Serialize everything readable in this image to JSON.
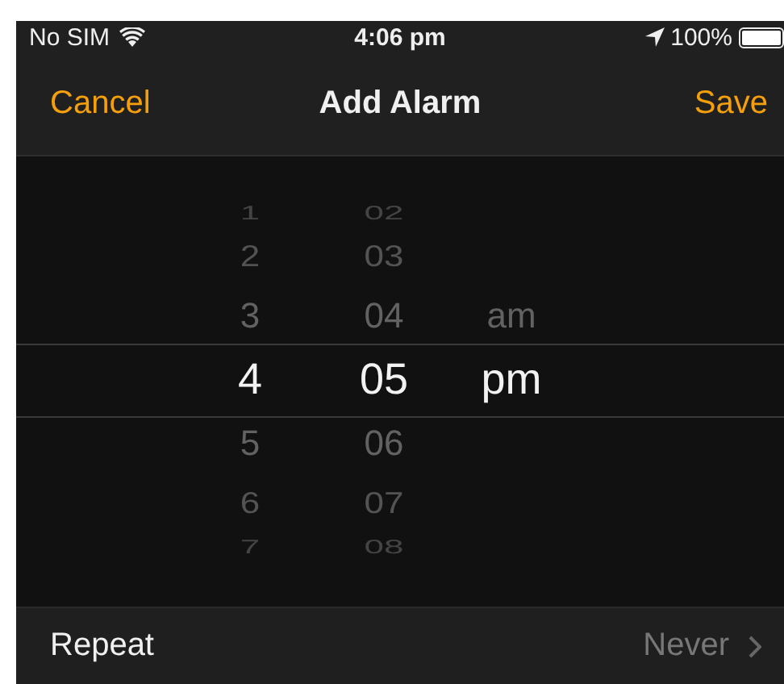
{
  "status_bar": {
    "carrier": "No SIM",
    "time": "4:06 pm",
    "battery": "100%"
  },
  "nav_bar": {
    "cancel": "Cancel",
    "title": "Add Alarm",
    "save": "Save"
  },
  "picker": {
    "columns": [
      {
        "items": [
          {
            "label": "1",
            "selected": false
          },
          {
            "label": "2",
            "selected": false
          },
          {
            "label": "3",
            "selected": false
          },
          {
            "label": "4",
            "selected": true
          },
          {
            "label": "5",
            "selected": false
          },
          {
            "label": "6",
            "selected": false
          },
          {
            "label": "7",
            "selected": false
          }
        ]
      },
      {
        "items": [
          {
            "label": "02",
            "selected": false
          },
          {
            "label": "03",
            "selected": false
          },
          {
            "label": "04",
            "selected": false
          },
          {
            "label": "05",
            "selected": true
          },
          {
            "label": "06",
            "selected": false
          },
          {
            "label": "07",
            "selected": false
          },
          {
            "label": "08",
            "selected": false
          }
        ]
      },
      {
        "items": [
          {
            "label": "am",
            "selected": false
          },
          {
            "label": "pm",
            "selected": true
          }
        ]
      }
    ]
  },
  "settings": [
    {
      "label": "Repeat",
      "value": "Never"
    }
  ]
}
